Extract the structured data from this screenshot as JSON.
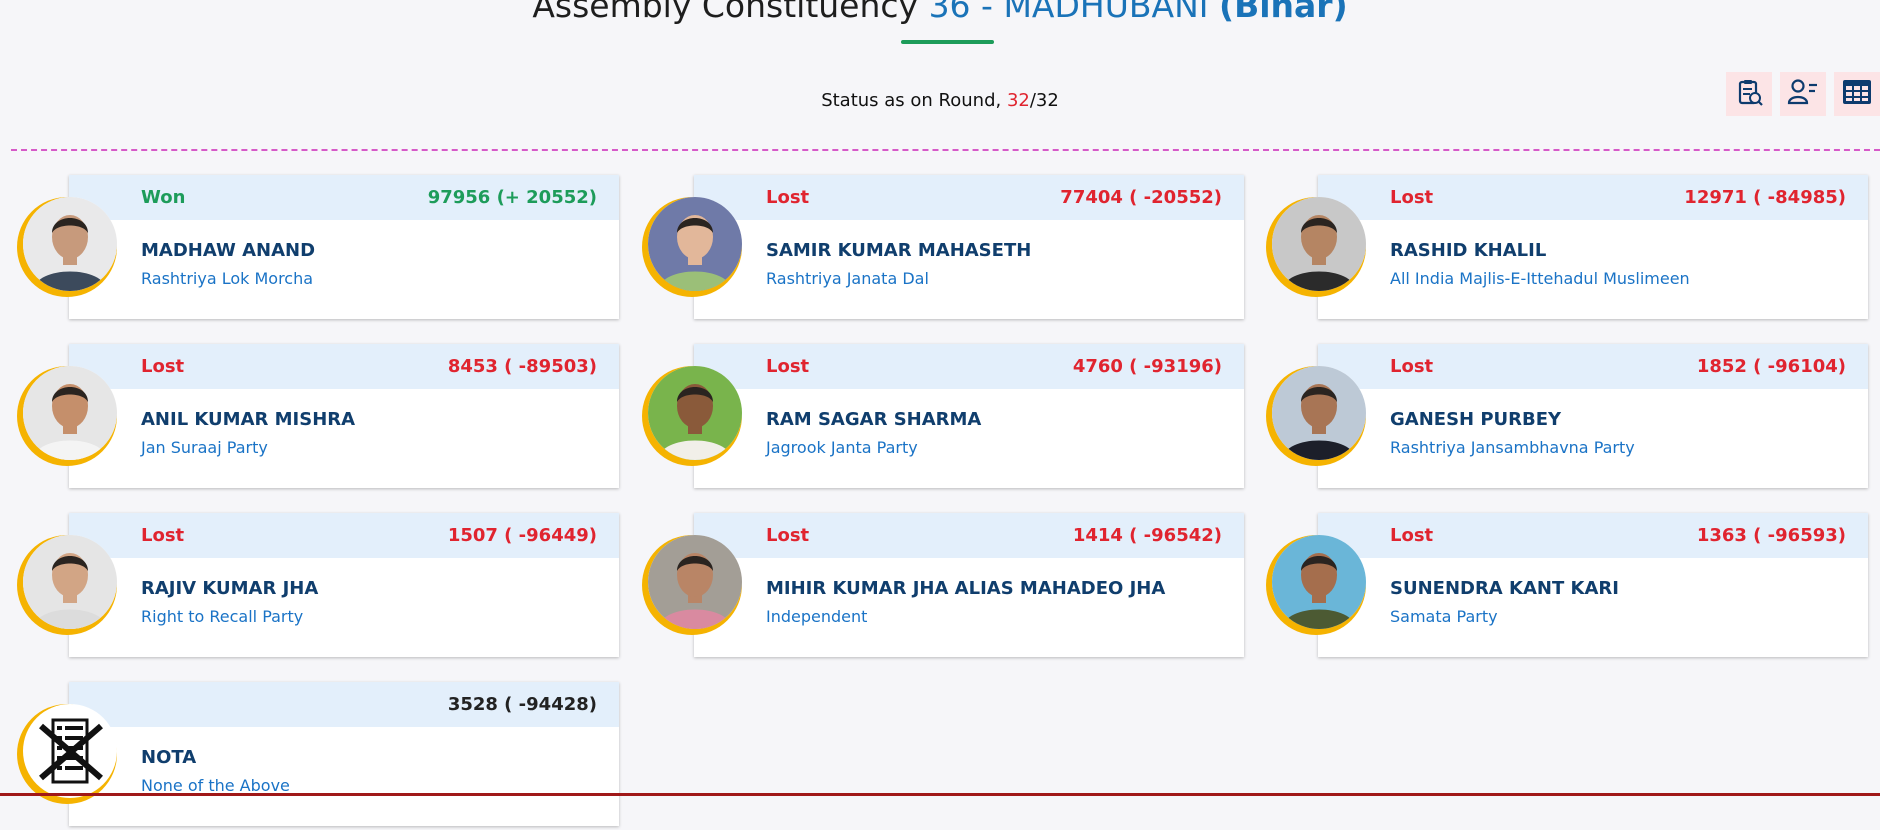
{
  "header": {
    "title_prefix": "Assembly Constituency ",
    "constituency": "36 - MADHUBANI",
    "state": "(Bihar)"
  },
  "status": {
    "label": "Status as on Round, ",
    "current_round": "32",
    "total_rounds": "/32"
  },
  "toolbar": {
    "icons": [
      "report-clipboard-icon",
      "candidate-list-icon",
      "table-grid-icon"
    ]
  },
  "colors": {
    "won": "#1d9c5a",
    "lost": "#e0242f",
    "name": "#103e6d",
    "party": "#1a73c6",
    "accent_ring": "#f5b301"
  },
  "candidates": [
    {
      "result": "Won",
      "votes": "97956 (+ 20552)",
      "name": "MADHAW ANAND",
      "party": "Rashtriya Lok Morcha",
      "status": "won",
      "skin": "#c79a7c",
      "shirt": "#3c4a5c",
      "bg": "#e9e9ea"
    },
    {
      "result": "Lost",
      "votes": "77404 ( -20552)",
      "name": "SAMIR KUMAR MAHASETH",
      "party": "Rashtriya Janata Dal",
      "status": "lost",
      "skin": "#e2b79a",
      "shirt": "#9bbf78",
      "bg": "#6f7aa8"
    },
    {
      "result": "Lost",
      "votes": "12971 ( -84985)",
      "name": "RASHID KHALIL",
      "party": "All India Majlis-E-Ittehadul Muslimeen",
      "status": "lost",
      "skin": "#b58563",
      "shirt": "#2b2b2b",
      "bg": "#c8c8c8"
    },
    {
      "result": "Lost",
      "votes": "8453 ( -89503)",
      "name": "ANIL KUMAR MISHRA",
      "party": "Jan Suraaj Party",
      "status": "lost",
      "skin": "#c58f6b",
      "shirt": "#f4f4f4",
      "bg": "#e6e6e6"
    },
    {
      "result": "Lost",
      "votes": "4760 ( -93196)",
      "name": "RAM SAGAR SHARMA",
      "party": "Jagrook Janta Party",
      "status": "lost",
      "skin": "#8a5a3a",
      "shirt": "#f1efe9",
      "bg": "#79b44c"
    },
    {
      "result": "Lost",
      "votes": "1852 ( -96104)",
      "name": "GANESH PURBEY",
      "party": "Rashtriya Jansambhavna Party",
      "status": "lost",
      "skin": "#a87555",
      "shirt": "#1c1f2a",
      "bg": "#bdc9d6"
    },
    {
      "result": "Lost",
      "votes": "1507 ( -96449)",
      "name": "RAJIV KUMAR JHA",
      "party": "Right to Recall Party",
      "status": "lost",
      "skin": "#d2a585",
      "shirt": "#dcdcdc",
      "bg": "#e5e5e5"
    },
    {
      "result": "Lost",
      "votes": "1414 ( -96542)",
      "name": "MIHIR KUMAR JHA ALIAS MAHADEO JHA",
      "party": "Independent",
      "status": "lost",
      "skin": "#b98566",
      "shirt": "#d98aa0",
      "bg": "#a39e96"
    },
    {
      "result": "Lost",
      "votes": "1363 ( -96593)",
      "name": "SUNENDRA KANT KARI",
      "party": "Samata Party",
      "status": "lost",
      "skin": "#a56e4d",
      "shirt": "#4c5a33",
      "bg": "#6ab6d8"
    },
    {
      "result": "",
      "votes": "3528 ( -94428)",
      "name": "NOTA",
      "party": "None of the Above",
      "status": "nota"
    }
  ]
}
